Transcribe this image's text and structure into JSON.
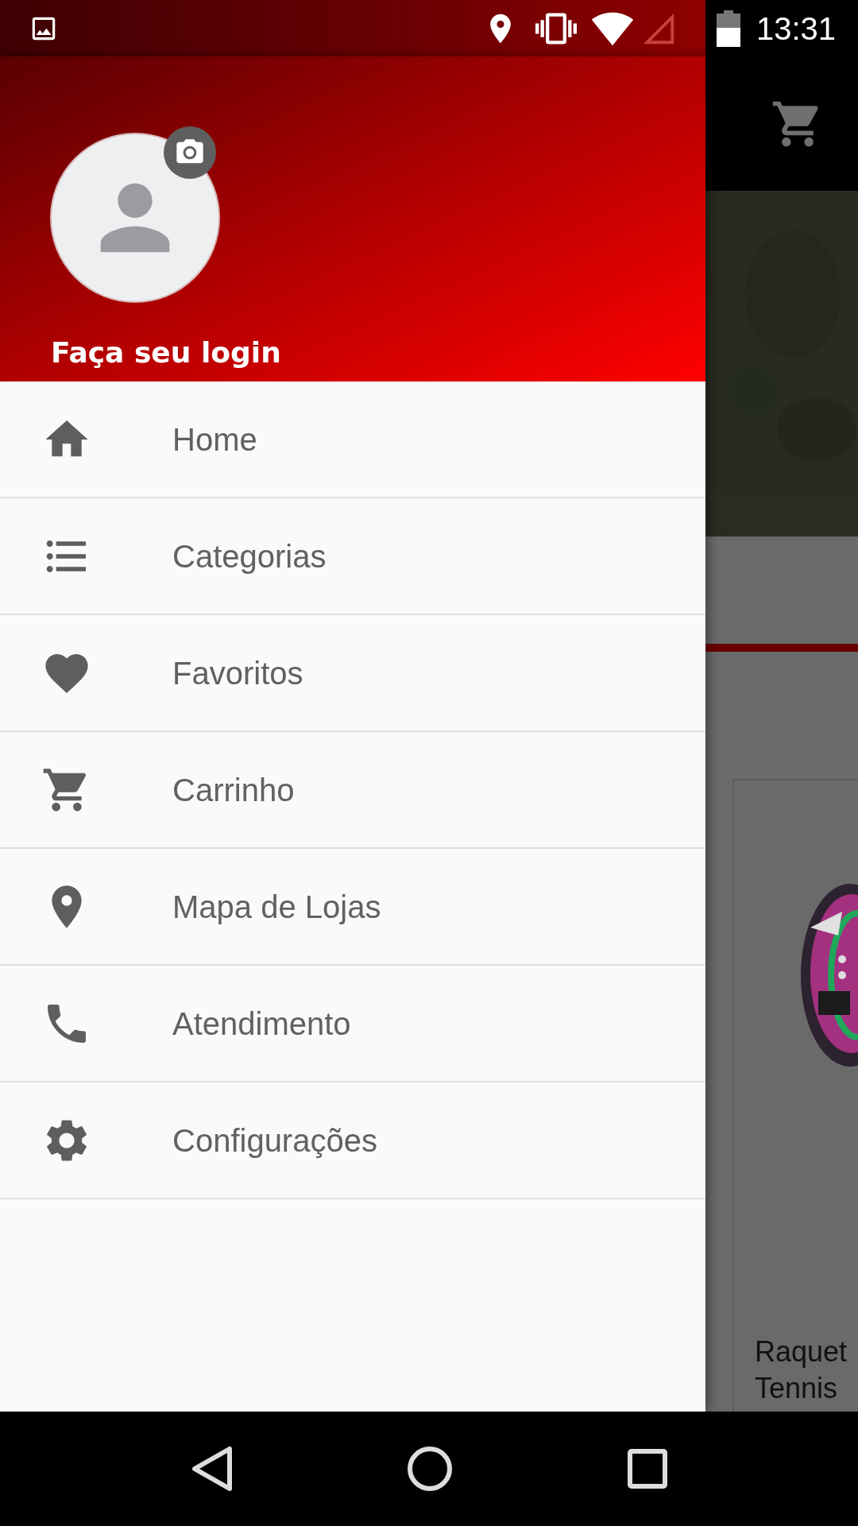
{
  "status_bar": {
    "time": "13:31"
  },
  "drawer": {
    "login_label": "Faça seu login",
    "items": [
      {
        "label": "Home",
        "kind": "home"
      },
      {
        "label": "Categorias",
        "kind": "list"
      },
      {
        "label": "Favoritos",
        "kind": "heart"
      },
      {
        "label": "Carrinho",
        "kind": "cart"
      },
      {
        "label": "Mapa de Lojas",
        "kind": "pin"
      },
      {
        "label": "Atendimento",
        "kind": "phone"
      },
      {
        "label": "Configurações",
        "kind": "gear"
      }
    ]
  },
  "background_page": {
    "product_title_lines": [
      "Raquet",
      "Tennis"
    ]
  }
}
